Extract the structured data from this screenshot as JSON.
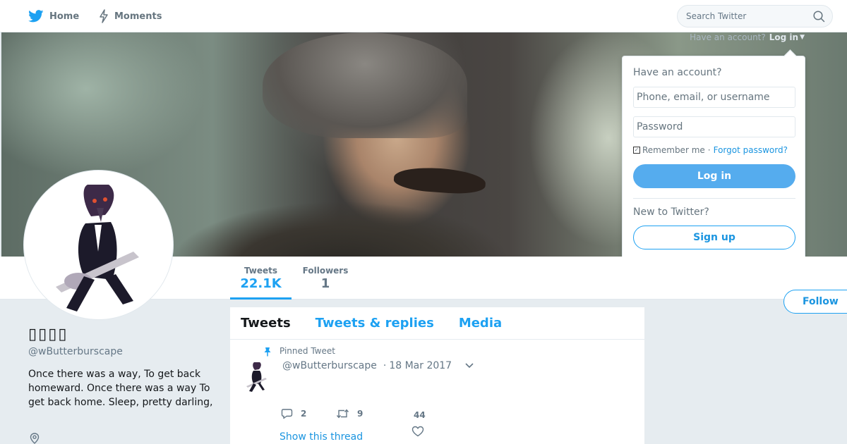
{
  "nav": {
    "home_label": "Home",
    "moments_label": "Moments",
    "search_placeholder": "Search Twitter"
  },
  "banner": {
    "login_prompt": "Have an account?",
    "login_link": "Log in"
  },
  "login_dropdown": {
    "title": "Have an account?",
    "username_placeholder": "Phone, email, or username",
    "password_placeholder": "Password",
    "remember_label": "Remember me",
    "separator": "·",
    "forgot_label": "Forgot password?",
    "login_button": "Log in",
    "new_label": "New to Twitter?",
    "signup_button": "Sign up"
  },
  "profile_nav": {
    "tweets_label": "Tweets",
    "tweets_count": "22.1K",
    "followers_label": "Followers",
    "followers_count": "1",
    "follow_button": "Follow"
  },
  "profile": {
    "name": "▯▯▯▯",
    "handle": "@wButterburscape",
    "bio": "Once there was a way, To get back homeward. Once there was a way To get back home. Sleep, pretty darling,"
  },
  "timeline": {
    "tabs": [
      {
        "label": "Tweets",
        "active": true
      },
      {
        "label": "Tweets & replies",
        "active": false
      },
      {
        "label": "Media",
        "active": false
      }
    ],
    "pinned_tweet": {
      "pinned_label": "Pinned Tweet",
      "handle": "@wButterburscape",
      "separator": "·",
      "date": "18 Mar 2017",
      "reply_count": "2",
      "retweet_count": "9",
      "like_count": "44",
      "show_thread": "Show this thread"
    }
  },
  "colors": {
    "accent": "#1da1f2",
    "link": "#1b95e0",
    "login_button": "#55acee",
    "background": "#e6ecf0"
  },
  "icons": [
    "twitter-bird-icon",
    "lightning-icon",
    "search-icon",
    "chevron-down-icon",
    "pin-icon",
    "reply-icon",
    "retweet-icon",
    "heart-icon",
    "location-icon"
  ]
}
